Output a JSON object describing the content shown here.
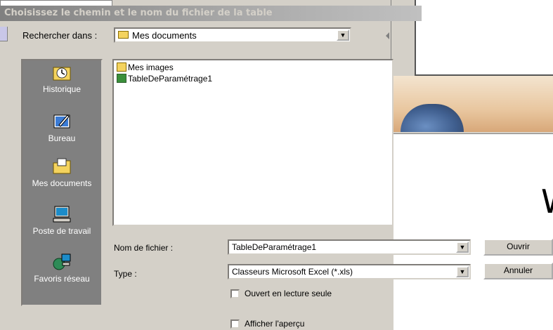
{
  "dialog": {
    "title": "Choisissez le chemin et le nom du fichier de la table",
    "lookin_label": "Rechercher dans :",
    "lookin_value": "Mes documents"
  },
  "places": [
    {
      "label": "Historique",
      "icon": "history-icon"
    },
    {
      "label": "Bureau",
      "icon": "desktop-icon"
    },
    {
      "label": "Mes documents",
      "icon": "my-documents-icon"
    },
    {
      "label": "Poste de travail",
      "icon": "my-computer-icon"
    },
    {
      "label": "Favoris réseau",
      "icon": "network-places-icon"
    }
  ],
  "files": [
    {
      "name": "Mes images",
      "icon": "folder-icon"
    },
    {
      "name": "TableDeParamétrage1",
      "icon": "excel-file-icon"
    }
  ],
  "filename": {
    "label": "Nom de fichier :",
    "value": "TableDeParamétrage1"
  },
  "filetype": {
    "label": "Type :",
    "value": "Classeurs Microsoft Excel (*.xls)"
  },
  "buttons": {
    "open": "Ouvrir",
    "cancel": "Annuler"
  },
  "options": {
    "readonly_label": "Ouvert en lecture seule",
    "preview_label": "Afficher l'aperçu"
  },
  "background": {
    "partial_letter": "W"
  },
  "colors": {
    "placesbar": "#808080",
    "dialog_bg": "#d4d0c8",
    "titlebar": "#808080"
  }
}
